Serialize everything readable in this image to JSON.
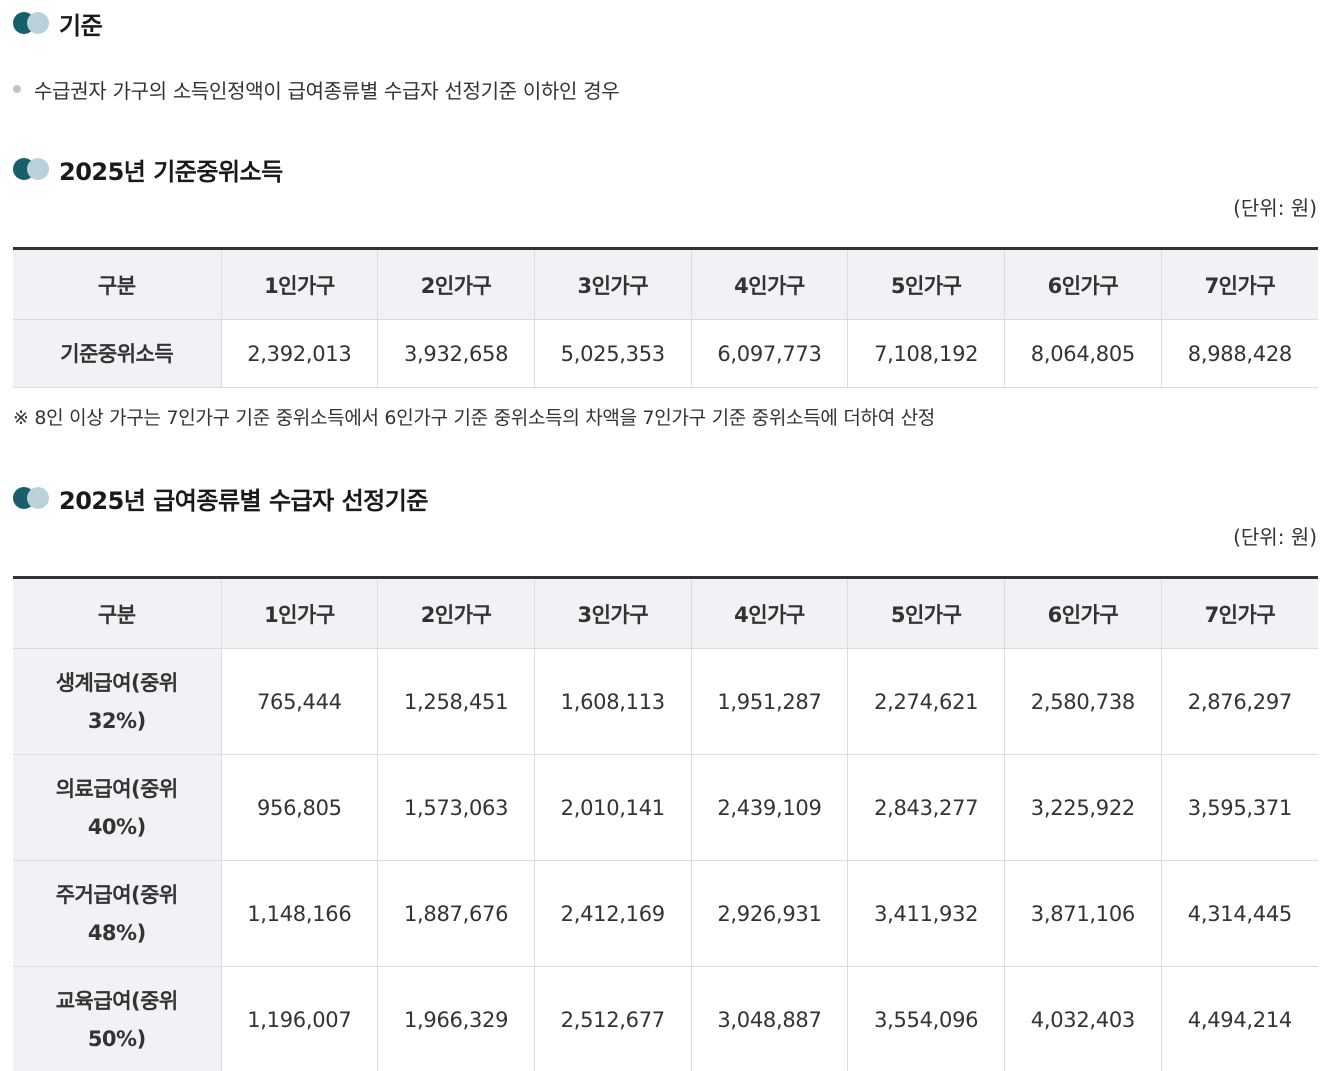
{
  "section1": {
    "title": "기준",
    "bullet": "수급권자 가구의 소득인정액이 급여종류별 수급자 선정기준 이하인 경우"
  },
  "section2": {
    "title": "2025년 기준중위소득",
    "unit": "(단위: 원)",
    "headers": [
      "구분",
      "1인가구",
      "2인가구",
      "3인가구",
      "4인가구",
      "5인가구",
      "6인가구",
      "7인가구"
    ],
    "rows": [
      {
        "label": "기준중위소득",
        "values": [
          "2,392,013",
          "3,932,658",
          "5,025,353",
          "6,097,773",
          "7,108,192",
          "8,064,805",
          "8,988,428"
        ]
      }
    ],
    "note": "※ 8인 이상 가구는 7인가구 기준 중위소득에서 6인가구 기준 중위소득의 차액을 7인가구 기준 중위소득에 더하여 산정"
  },
  "section3": {
    "title": "2025년 급여종류별 수급자 선정기준",
    "unit": "(단위: 원)",
    "headers": [
      "구분",
      "1인가구",
      "2인가구",
      "3인가구",
      "4인가구",
      "5인가구",
      "6인가구",
      "7인가구"
    ],
    "rows": [
      {
        "label_line1": "생계급여(중위",
        "label_line2": "32%)",
        "values": [
          "765,444",
          "1,258,451",
          "1,608,113",
          "1,951,287",
          "2,274,621",
          "2,580,738",
          "2,876,297"
        ]
      },
      {
        "label_line1": "의료급여(중위",
        "label_line2": "40%)",
        "values": [
          "956,805",
          "1,573,063",
          "2,010,141",
          "2,439,109",
          "2,843,277",
          "3,225,922",
          "3,595,371"
        ]
      },
      {
        "label_line1": "주거급여(중위",
        "label_line2": "48%)",
        "values": [
          "1,148,166",
          "1,887,676",
          "2,412,169",
          "2,926,931",
          "3,411,932",
          "3,871,106",
          "4,314,445"
        ]
      },
      {
        "label_line1": "교육급여(중위",
        "label_line2": "50%)",
        "values": [
          "1,196,007",
          "1,966,329",
          "2,512,677",
          "3,048,887",
          "3,554,096",
          "4,032,403",
          "4,494,214"
        ]
      }
    ]
  },
  "colors": {
    "heading_dot_dark": "#185f6b",
    "heading_dot_light": "#b9d2da",
    "table_header_bg": "#f0f2f5",
    "table_top_border": "#333333"
  },
  "icons": {
    "heading_marker": "two-dot-heading-icon",
    "bullet": "bullet-dot-icon"
  }
}
